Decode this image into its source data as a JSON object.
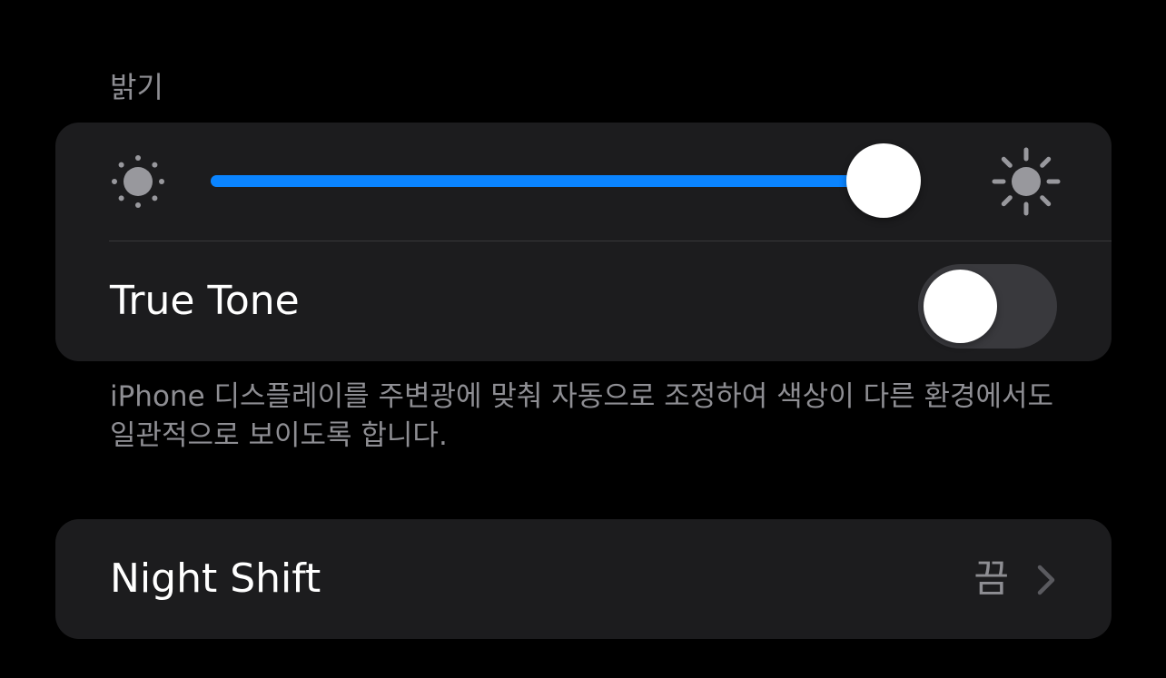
{
  "brightness": {
    "header": "밝기",
    "level": 0.955,
    "min_icon": "sun-min-icon",
    "max_icon": "sun-max-icon",
    "accent_color": "#0a84ff"
  },
  "true_tone": {
    "label": "True Tone",
    "enabled": false,
    "footer": "iPhone 디스플레이를 주변광에 맞춰 자동으로 조정하여 색상이 다른 환경에서도 일관적으로 보이도록 합니다."
  },
  "night_shift": {
    "label": "Night Shift",
    "value": "끔",
    "icon": "chevron-right-icon"
  }
}
